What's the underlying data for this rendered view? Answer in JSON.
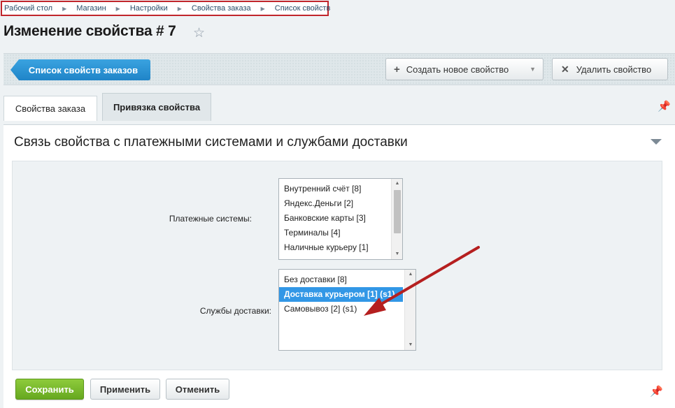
{
  "breadcrumb": [
    "Рабочий стол",
    "Магазин",
    "Настройки",
    "Свойства заказа",
    "Список свойств"
  ],
  "page_title": "Изменение свойства # 7",
  "toolbar": {
    "back_label": "Список свойств заказов",
    "create_label": "Создать новое свойство",
    "delete_label": "Удалить свойство"
  },
  "tabs": [
    {
      "label": "Свойства заказа",
      "active": false
    },
    {
      "label": "Привязка свойства",
      "active": true
    }
  ],
  "section": {
    "title": "Связь свойства с платежными системами и службами доставки"
  },
  "payment": {
    "label": "Платежные системы:",
    "options": [
      "Внутренний счёт [8]",
      "Яндекс.Деньги [2]",
      "Банковские карты [3]",
      "Терминалы [4]",
      "Наличные курьеру [1]"
    ]
  },
  "delivery": {
    "label": "Службы доставки:",
    "options": [
      "Без доставки [8]",
      "Доставка курьером [1] (s1)",
      "Самовывоз [2] (s1)"
    ],
    "selected_index": 1
  },
  "buttons": {
    "save": "Сохранить",
    "apply": "Применить",
    "cancel": "Отменить"
  },
  "colors": {
    "accent_blue": "#2a93d8",
    "save_green": "#76b82a",
    "highlight_border": "#c1262c",
    "annotation_arrow": "#b51f1f"
  }
}
